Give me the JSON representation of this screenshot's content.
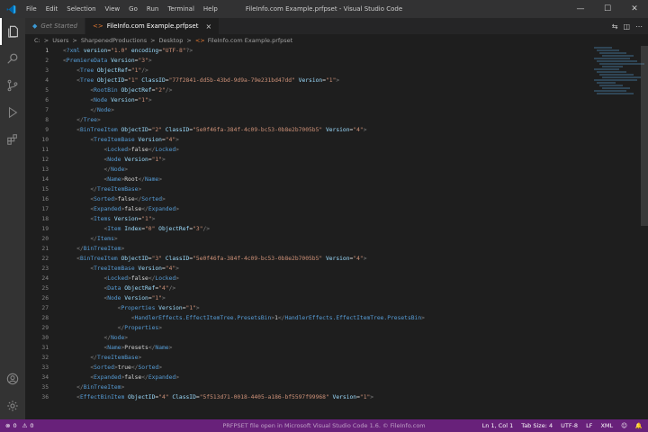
{
  "window": {
    "title": "FileInfo.com Example.prfpset - Visual Studio Code",
    "menu": [
      "File",
      "Edit",
      "Selection",
      "View",
      "Go",
      "Run",
      "Terminal",
      "Help"
    ],
    "controls": {
      "minimize": "—",
      "maximize": "☐",
      "close": "✕"
    }
  },
  "tabs": [
    {
      "label": "Get Started",
      "icon": "vscode-icon",
      "active": false
    },
    {
      "label": "FileInfo.com Example.prfpset",
      "icon": "xml-file-icon",
      "active": true,
      "close": "×"
    }
  ],
  "editor_actions": [
    "⇆",
    "◫",
    "⋯"
  ],
  "breadcrumb": [
    "C:",
    "Users",
    "SharpenedProductions",
    "Desktop",
    "FileInfo.com Example.prfpset"
  ],
  "breadcrumb_sep": ">",
  "activity_icons": [
    "explorer-icon",
    "search-icon",
    "source-control-icon",
    "run-debug-icon",
    "extensions-icon",
    "account-icon",
    "settings-gear-icon"
  ],
  "line_numbers": [
    "1",
    "2",
    "3",
    "4",
    "5",
    "6",
    "7",
    "8",
    "9",
    "10",
    "11",
    "12",
    "13",
    "14",
    "15",
    "16",
    "17",
    "18",
    "19",
    "20",
    "21",
    "22",
    "23",
    "24",
    "25",
    "26",
    "27",
    "28",
    "29",
    "30",
    "31",
    "32",
    "33",
    "34",
    "35",
    "36"
  ],
  "code_lines": [
    "<?xml version=\"1.0\" encoding=\"UTF-8\"?>",
    "<PremiereData Version=\"3\">",
    "    <Tree ObjectRef=\"1\"/>",
    "    <Tree ObjectID=\"1\" ClassID=\"77f2841-dd5b-43bd-9d9a-79e231bd47dd\" Version=\"1\">",
    "        <RootBin ObjectRef=\"2\"/>",
    "        <Node Version=\"1\">",
    "        </Node>",
    "    </Tree>",
    "    <BinTreeItem ObjectID=\"2\" ClassID=\"5e0f46fa-384f-4c09-bc53-0b8e2b7005b5\" Version=\"4\">",
    "        <TreeItemBase Version=\"4\">",
    "            <Locked>false</Locked>",
    "            <Node Version=\"1\">",
    "            </Node>",
    "            <Name>Root</Name>",
    "        </TreeItemBase>",
    "        <Sorted>false</Sorted>",
    "        <Expanded>false</Expanded>",
    "        <Items Version=\"1\">",
    "            <Item Index=\"0\" ObjectRef=\"3\"/>",
    "        </Items>",
    "    </BinTreeItem>",
    "    <BinTreeItem ObjectID=\"3\" ClassID=\"5e0f46fa-384f-4c09-bc53-0b8e2b7005b5\" Version=\"4\">",
    "        <TreeItemBase Version=\"4\">",
    "            <Locked>false</Locked>",
    "            <Data ObjectRef=\"4\"/>",
    "            <Node Version=\"1\">",
    "                <Properties Version=\"1\">",
    "                    <HandlerEffects.EffectItemTree.PresetsBin>1</HandlerEffects.EffectItemTree.PresetsBin>",
    "                </Properties>",
    "            </Node>",
    "            <Name>Presets</Name>",
    "        </TreeItemBase>",
    "        <Sorted>true</Sorted>",
    "        <Expanded>false</Expanded>",
    "    </BinTreeItem>",
    "    <EffectBinItem ObjectID=\"4\" ClassID=\"5f513d71-0018-4405-a186-bf5597f99968\" Version=\"1\">"
  ],
  "status": {
    "errors": "0",
    "warnings": "0",
    "center": "PRFPSET file open in Microsoft Visual Studio Code 1.6. © FileInfo.com",
    "right": [
      "Ln 1, Col 1",
      "Tab Size: 4",
      "UTF-8",
      "LF",
      "XML",
      "☺",
      "🔔"
    ]
  },
  "colors": {
    "statusbar": "#68217a",
    "tag": "#569cd6",
    "attr": "#9cdcfe",
    "string": "#ce9178"
  }
}
